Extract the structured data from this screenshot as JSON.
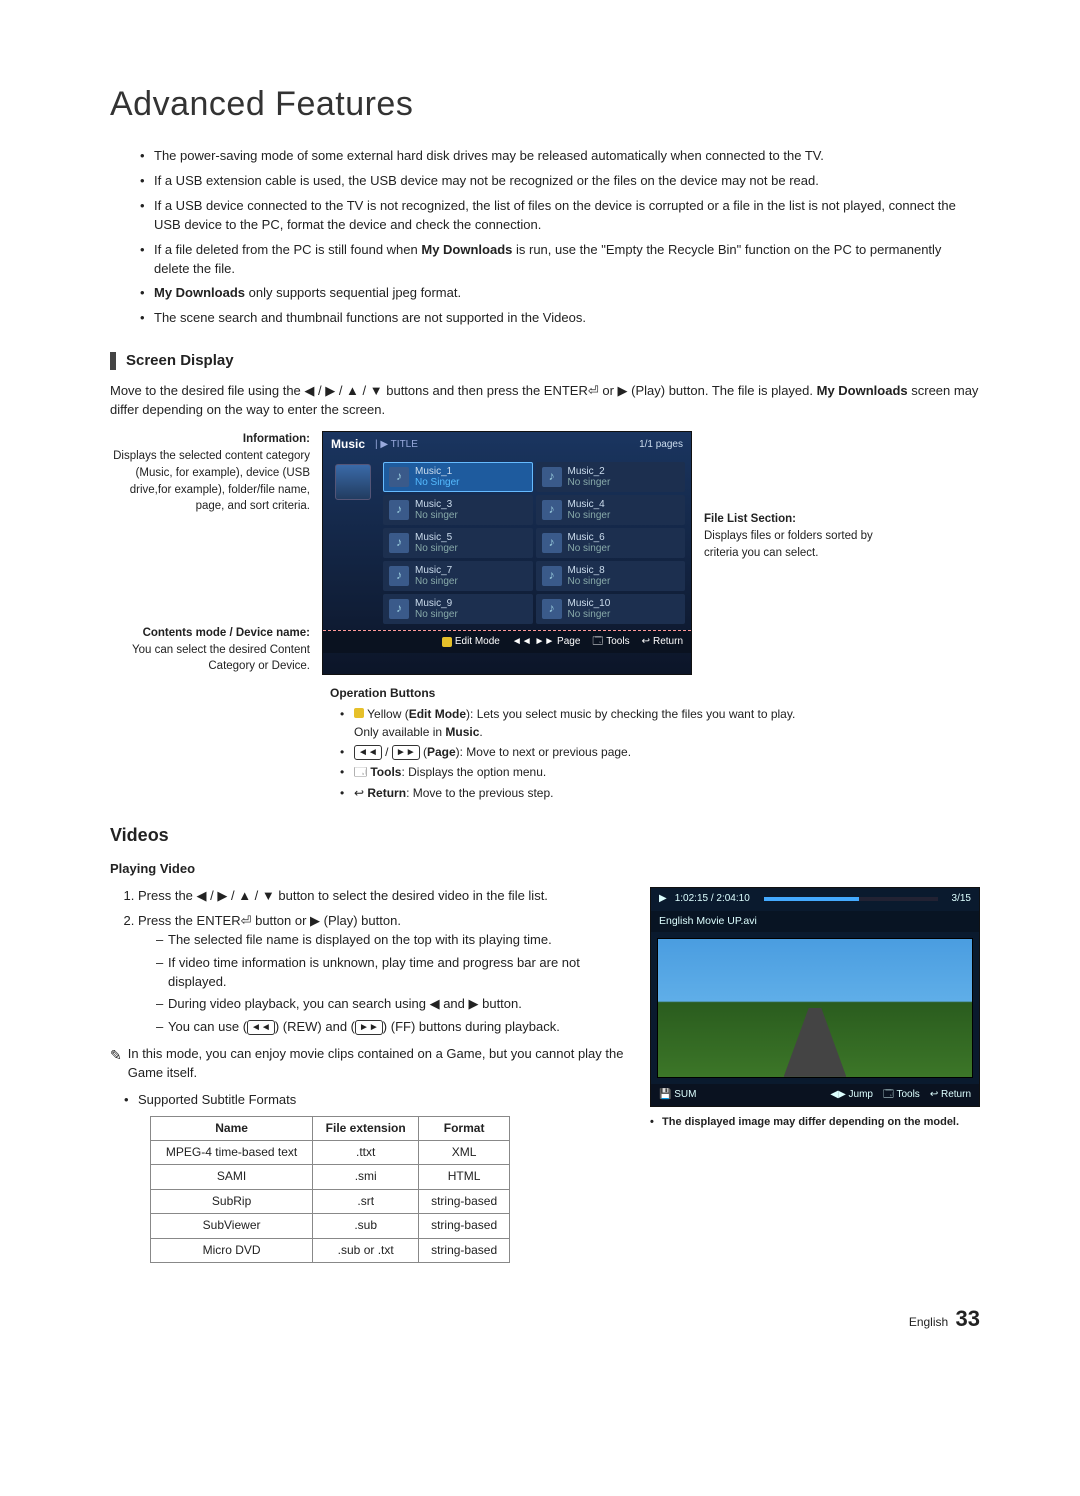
{
  "page_title": "Advanced Features",
  "usb_notes": [
    "The power-saving mode of some external hard disk drives may be released automatically when connected to the TV.",
    "If a USB extension cable is used, the USB device may not be recognized or the files on the device may not be read.",
    "If a USB device connected to the TV is not recognized, the list of files on the device is corrupted or a file in the list is not played, connect the USB device to the PC, format the device and check the connection.",
    "If a file deleted from the PC is still found when <b>My Downloads</b> is run, use the \"Empty the Recycle Bin\" function on the PC to permanently delete the file.",
    "<b>My Downloads</b> only supports sequential jpeg format.",
    "The scene search and thumbnail functions are not supported in the Videos."
  ],
  "screen": {
    "heading": "Screen Display",
    "intro": "Move to the desired file using the ◀ / ▶ / ▲ / ▼ buttons and then press the ENTER⏎ or ▶ (Play) button. The file is played. <b>My Downloads</b> screen may differ depending on the way to enter the screen.",
    "info_label": "Information:",
    "info_text": "Displays the selected content category (Music, for example), device (USB drive,for example), folder/file name, page, and sort criteria.",
    "mode_label": "Contents mode / Device name:",
    "mode_text": "You can select the desired Content Category or Device.",
    "filelist_label": "File List Section:",
    "filelist_text": "Displays files or folders sorted by criteria you can select.",
    "tv": {
      "title": "Music",
      "sort": "| ▶ TITLE",
      "pages": "1/1 pages",
      "items": [
        {
          "name": "Music_1",
          "sub": "No Singer",
          "selected": true
        },
        {
          "name": "Music_2",
          "sub": "No singer"
        },
        {
          "name": "Music_3",
          "sub": "No singer"
        },
        {
          "name": "Music_4",
          "sub": "No singer"
        },
        {
          "name": "Music_5",
          "sub": "No singer"
        },
        {
          "name": "Music_6",
          "sub": "No singer"
        },
        {
          "name": "Music_7",
          "sub": "No singer"
        },
        {
          "name": "Music_8",
          "sub": "No singer"
        },
        {
          "name": "Music_9",
          "sub": "No singer"
        },
        {
          "name": "Music_10",
          "sub": "No singer"
        }
      ],
      "footer": {
        "edit": "Edit Mode",
        "page": "◄◄ ►► Page",
        "tools": "Tools",
        "ret": "Return"
      }
    },
    "op": {
      "heading": "Operation Buttons",
      "items": [
        "<span class='c-btn c-yellow'></span> Yellow (<b>Edit Mode</b>): Lets you select music by checking the files you want to play. Only available in <b>Music</b>.",
        "<span class='key-icon'>◄◄</span> / <span class='key-icon'>►►</span> (<b>Page</b>): Move to next or previous page.",
        "🗔 <b>Tools</b>: Displays the option menu.",
        "↩ <b>Return</b>: Move to the previous step."
      ]
    }
  },
  "videos": {
    "heading": "Videos",
    "play_heading": "Playing Video",
    "step1": "Press the ◀ / ▶ / ▲ / ▼ button to select the desired video in the file list.",
    "step2_lead": "Press the ENTER⏎ button or ▶ (Play) button.",
    "step2_sub": [
      "The selected file name is displayed on the top with its playing time.",
      "If video time information is unknown, play time and progress bar are not displayed.",
      "During video playback, you can search using ◀ and ▶ button.",
      "You can use (<span class='key-icon'>◄◄</span>) (REW) and (<span class='key-icon'>►►</span>) (FF) buttons during playback."
    ],
    "note": "In this mode, you can enjoy movie clips contained on a Game, but you cannot play the Game itself.",
    "sub_formats_label": "Supported Subtitle Formats",
    "table": {
      "headers": [
        "Name",
        "File extension",
        "Format"
      ],
      "rows": [
        [
          "MPEG-4 time-based text",
          ".ttxt",
          "XML"
        ],
        [
          "SAMI",
          ".smi",
          "HTML"
        ],
        [
          "SubRip",
          ".srt",
          "string-based"
        ],
        [
          "SubViewer",
          ".sub",
          "string-based"
        ],
        [
          "Micro DVD",
          ".sub or .txt",
          "string-based"
        ]
      ]
    },
    "player": {
      "time": "1:02:15 / 2:04:10",
      "counter": "3/15",
      "title": "English Movie UP.avi",
      "sum": "SUM",
      "jump": "◀▶ Jump",
      "tools": "Tools",
      "ret": "Return"
    },
    "image_note": "The displayed image may differ depending on the model."
  },
  "footer": {
    "lang": "English",
    "page": "33"
  }
}
